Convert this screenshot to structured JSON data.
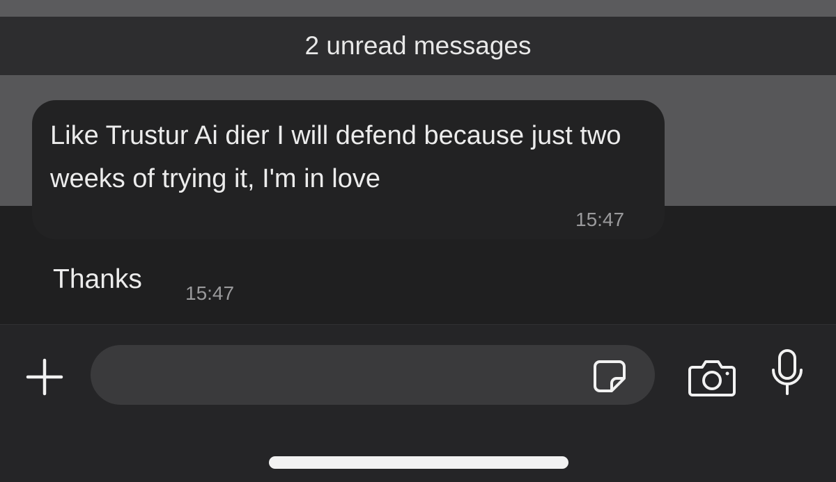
{
  "chat": {
    "unread_banner": "2 unread messages",
    "messages": [
      {
        "text": "Like Trustur Ai dier I will defend because just two weeks of trying it, I'm in love",
        "time": "15:47"
      },
      {
        "text": "Thanks",
        "time": "15:47"
      }
    ]
  },
  "composer": {
    "input_value": "",
    "input_placeholder": "",
    "icons": {
      "attach": "plus-icon",
      "sticker": "sticker-icon",
      "camera": "camera-icon",
      "voice": "microphone-icon"
    }
  },
  "colors": {
    "background": "#1f1f20",
    "bubble": "#222223",
    "unread_bar": "#2d2d2f",
    "highlight_band": "#575759",
    "input_field": "#3a3a3c",
    "text": "#ececec",
    "timestamp": "#9a9a9c"
  }
}
